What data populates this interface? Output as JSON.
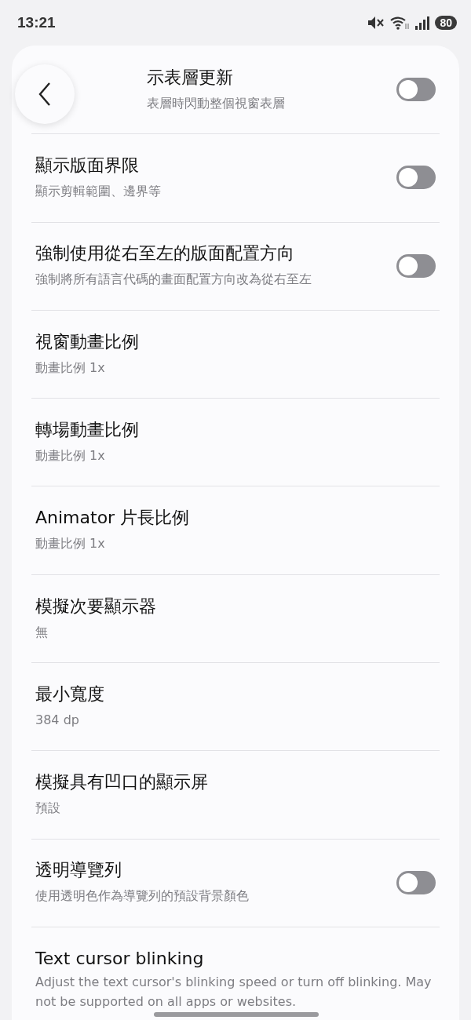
{
  "status_bar": {
    "time": "13:21",
    "battery": "80"
  },
  "settings": [
    {
      "title": "示表層更新",
      "subtitle": "表層時閃動整個視窗表層",
      "kind": "toggle",
      "on": false
    },
    {
      "title": "顯示版面界限",
      "subtitle": "顯示剪輯範圍、邊界等",
      "kind": "toggle",
      "on": false
    },
    {
      "title": "強制使用從右至左的版面配置方向",
      "subtitle": "強制將所有語言代碼的畫面配置方向改為從右至左",
      "kind": "toggle",
      "on": false
    },
    {
      "title": "視窗動畫比例",
      "subtitle": "動畫比例 1x",
      "kind": "value"
    },
    {
      "title": "轉場動畫比例",
      "subtitle": "動畫比例 1x",
      "kind": "value"
    },
    {
      "title": "Animator 片長比例",
      "subtitle": "動畫比例 1x",
      "kind": "value"
    },
    {
      "title": "模擬次要顯示器",
      "subtitle": "無",
      "kind": "value"
    },
    {
      "title": "最小寬度",
      "subtitle": "384 dp",
      "kind": "value"
    },
    {
      "title": "模擬具有凹口的顯示屏",
      "subtitle": "預設",
      "kind": "value"
    },
    {
      "title": "透明導覽列",
      "subtitle": "使用透明色作為導覽列的預設背景顏色",
      "kind": "toggle",
      "on": false
    },
    {
      "title": "Text cursor blinking",
      "subtitle": "Adjust the text cursor's blinking speed or turn off blinking. May not be supported on all apps or websites.",
      "kind": "value"
    }
  ]
}
